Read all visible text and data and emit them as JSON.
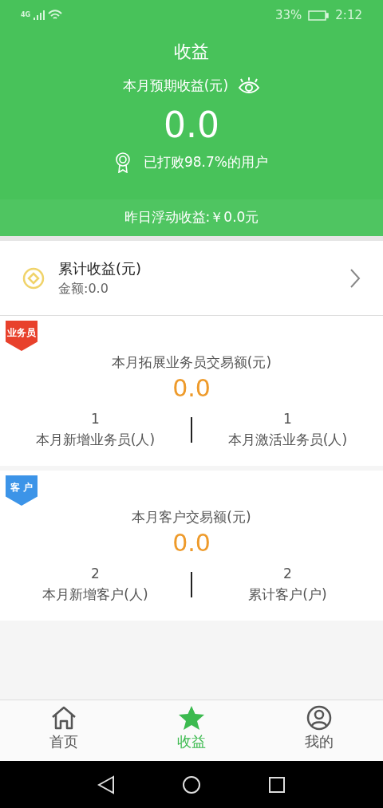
{
  "status_bar": {
    "network": "4G",
    "battery": "33%",
    "time": "2:12"
  },
  "header": {
    "title": "收益",
    "subtitle": "本月预期收益(元)",
    "amount": "0.0",
    "rank": "已打败98.7%的用户",
    "yesterday": "昨日浮动收益:￥0.0元"
  },
  "cumulative": {
    "title": "累计收益(元)",
    "amount": "金额:0.0"
  },
  "sections": [
    {
      "badge": "业务员",
      "color": "#e8412c",
      "title": "本月拓展业务员交易额(元)",
      "amount": "0.0",
      "stats": [
        {
          "value": "1",
          "label": "本月新增业务员(人)"
        },
        {
          "value": "1",
          "label": "本月激活业务员(人)"
        }
      ]
    },
    {
      "badge": "客 户",
      "color": "#3c94e8",
      "title": "本月客户交易额(元)",
      "amount": "0.0",
      "stats": [
        {
          "value": "2",
          "label": "本月新增客户(人)"
        },
        {
          "value": "2",
          "label": "累计客户(户)"
        }
      ]
    }
  ],
  "tabs": [
    {
      "kind": "home",
      "label": "首页",
      "selected": false
    },
    {
      "kind": "star",
      "label": "收益",
      "selected": true
    },
    {
      "kind": "user",
      "label": "我的",
      "selected": false
    }
  ]
}
